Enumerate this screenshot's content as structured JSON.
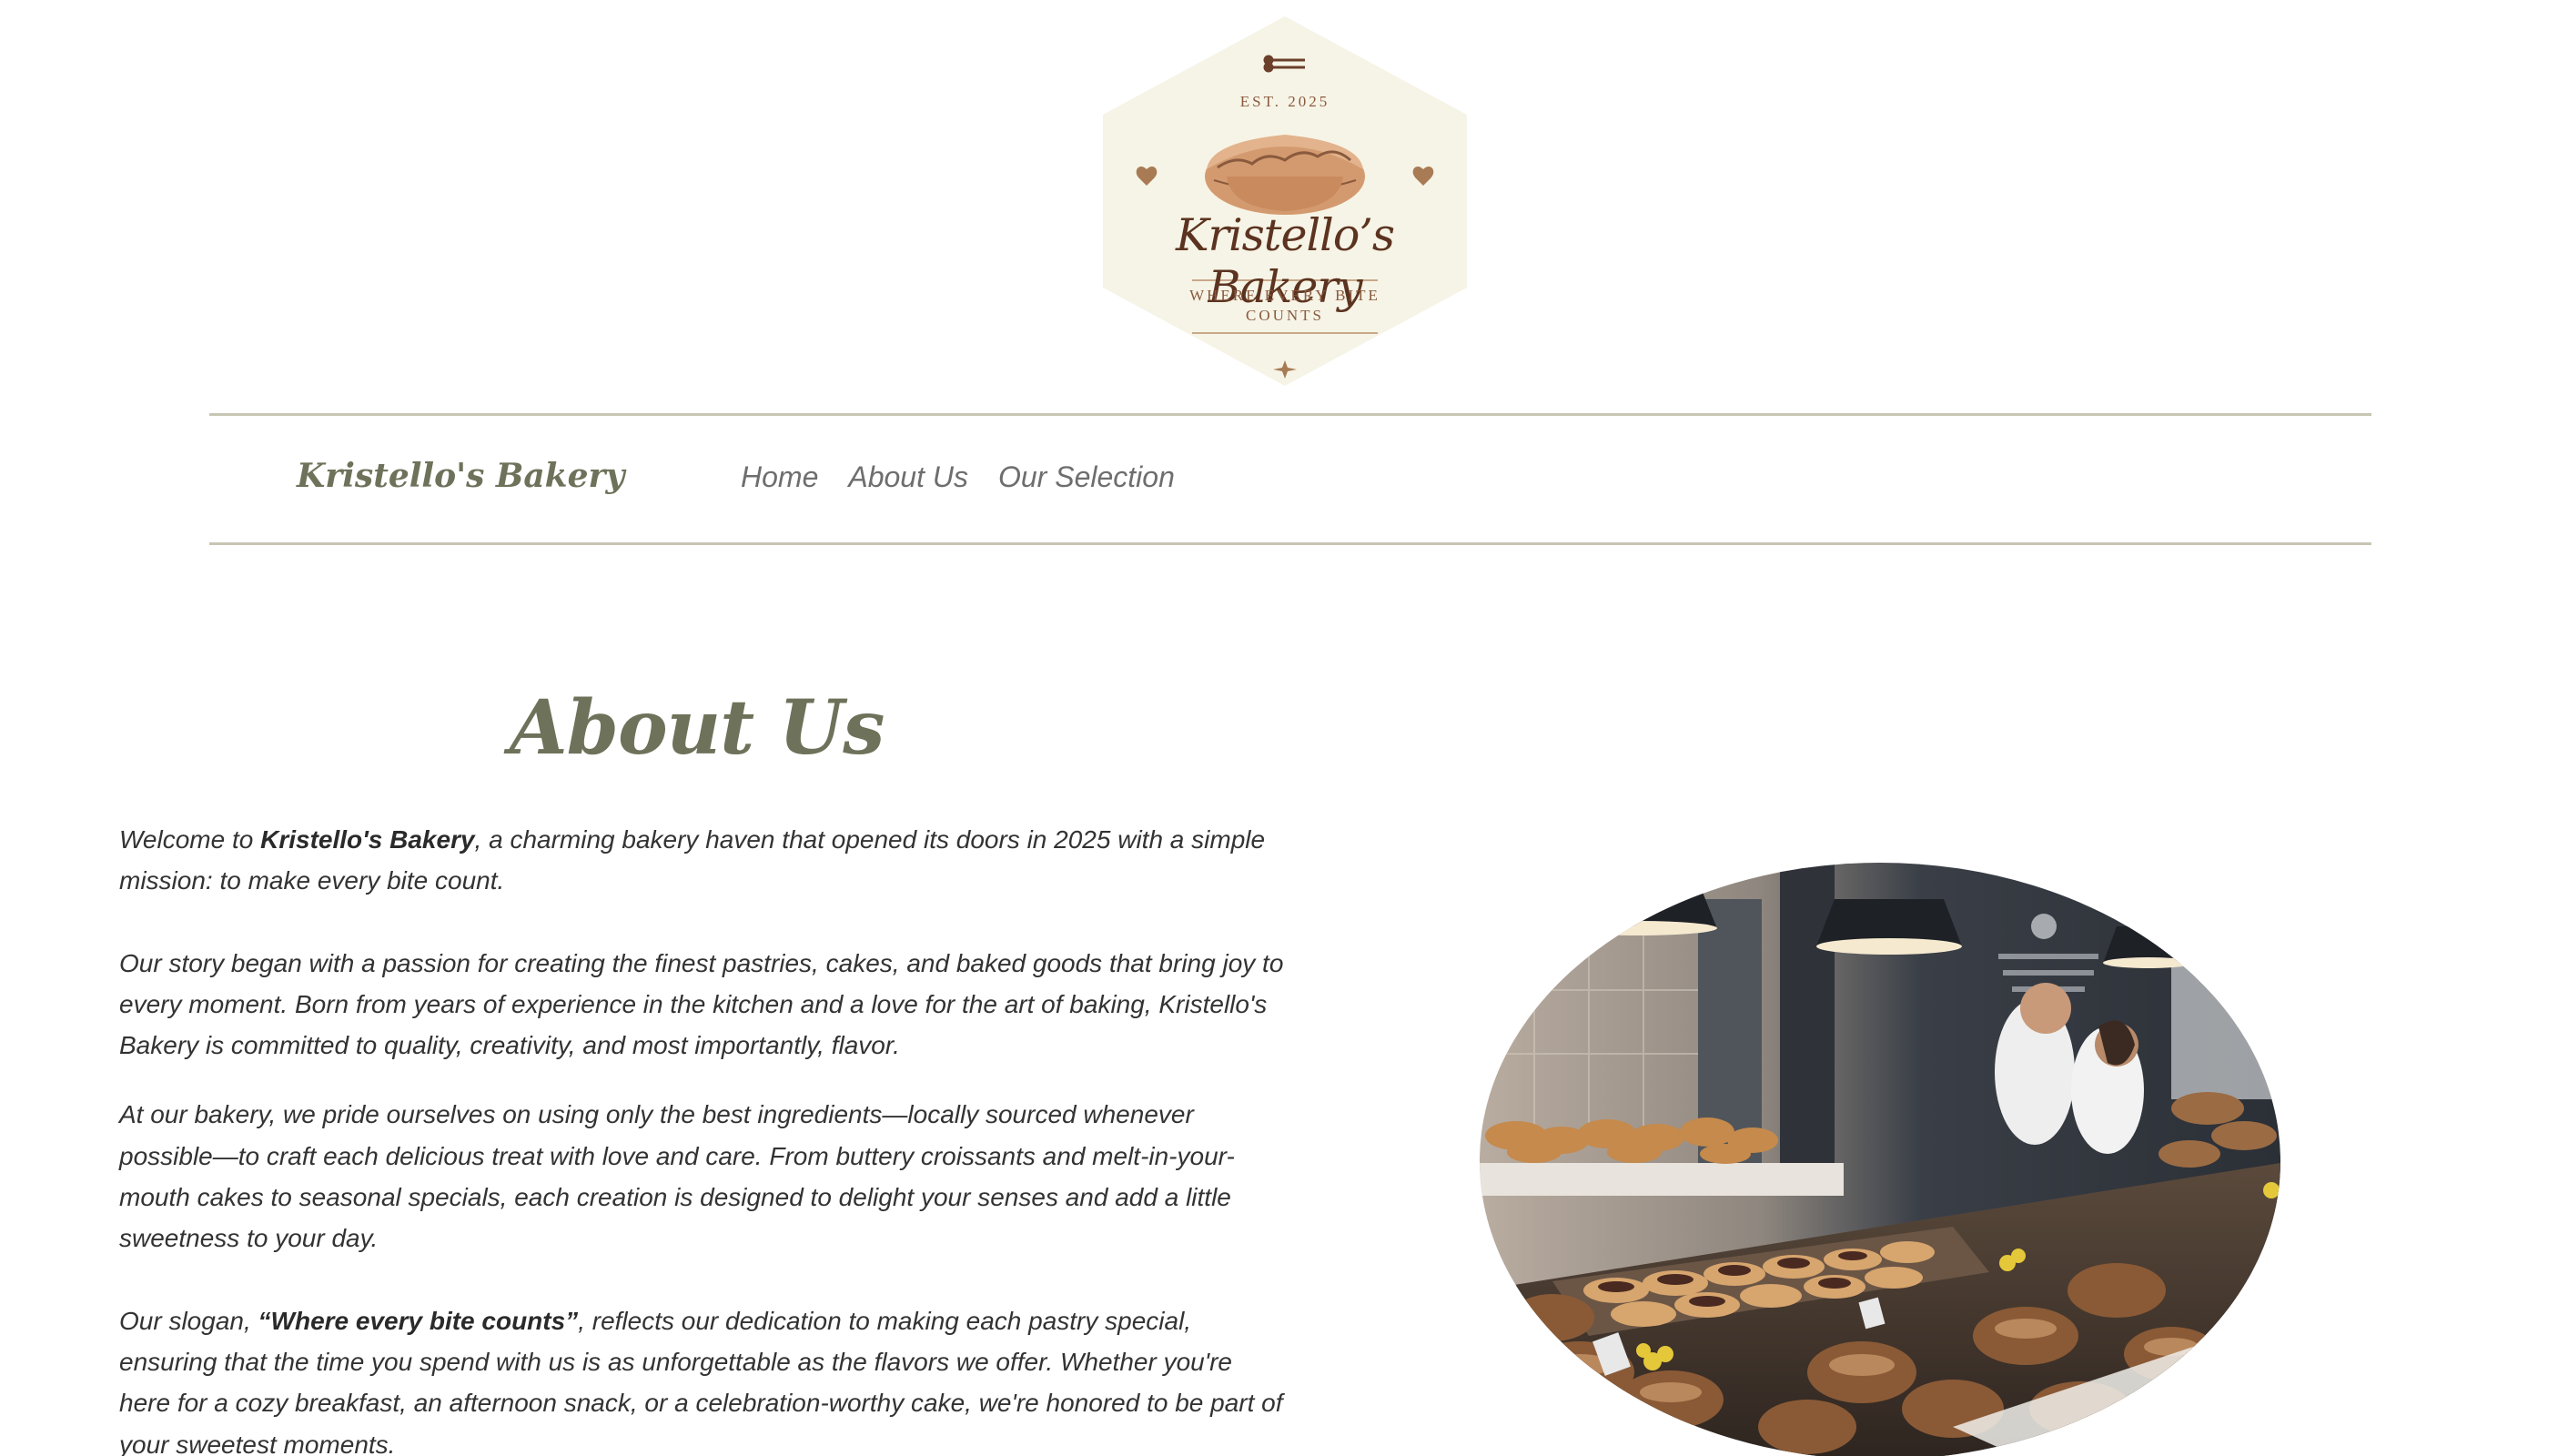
{
  "logo": {
    "est": "EST. 2025",
    "name": "Kristello’s Bakery",
    "slogan": "WHERE EVERY BITE COUNTS",
    "colors": {
      "bg": "#f6f4e6",
      "accent": "#a87b55",
      "text": "#5c3320"
    }
  },
  "nav": {
    "brand": "Kristello's Bakery",
    "links": [
      "Home",
      "About Us",
      "Our Selection"
    ]
  },
  "main": {
    "heading": "About Us",
    "p1_pre": "Welcome to ",
    "p1_bold": "Kristello's Bakery",
    "p1_post": ", a charming bakery haven that opened its doors in 2025 with a simple mission: to make every bite count.",
    "p2": "Our story began with a passion for creating the finest pastries, cakes, and baked goods that bring joy to every moment. Born from years of experience in the kitchen and a love for the art of baking, Kristello's Bakery is committed to quality, creativity, and most importantly, flavor.",
    "p3": "At our bakery, we pride ourselves on using only the best ingredients—locally sourced whenever possible—to craft each delicious treat with love and care. From buttery croissants and melt-in-your-mouth cakes to seasonal specials, each creation is designed to delight your senses and add a little sweetness to your day.",
    "p4_pre": "Our slogan, ",
    "p4_bold": "“Where every bite counts”",
    "p4_post": ", reflects our dedication to making each pastry special, ensuring that the time you spend with us is as unforgettable as the flavors we offer. Whether you're here for a cozy breakfast, an afternoon snack, or a celebration-worthy cake, we're honored to be part of your sweetest moments."
  },
  "colors": {
    "olive": "#6e725a",
    "nav_link": "#6e6e6e",
    "body_text": "#333333",
    "rule": "#c8c6b3"
  }
}
